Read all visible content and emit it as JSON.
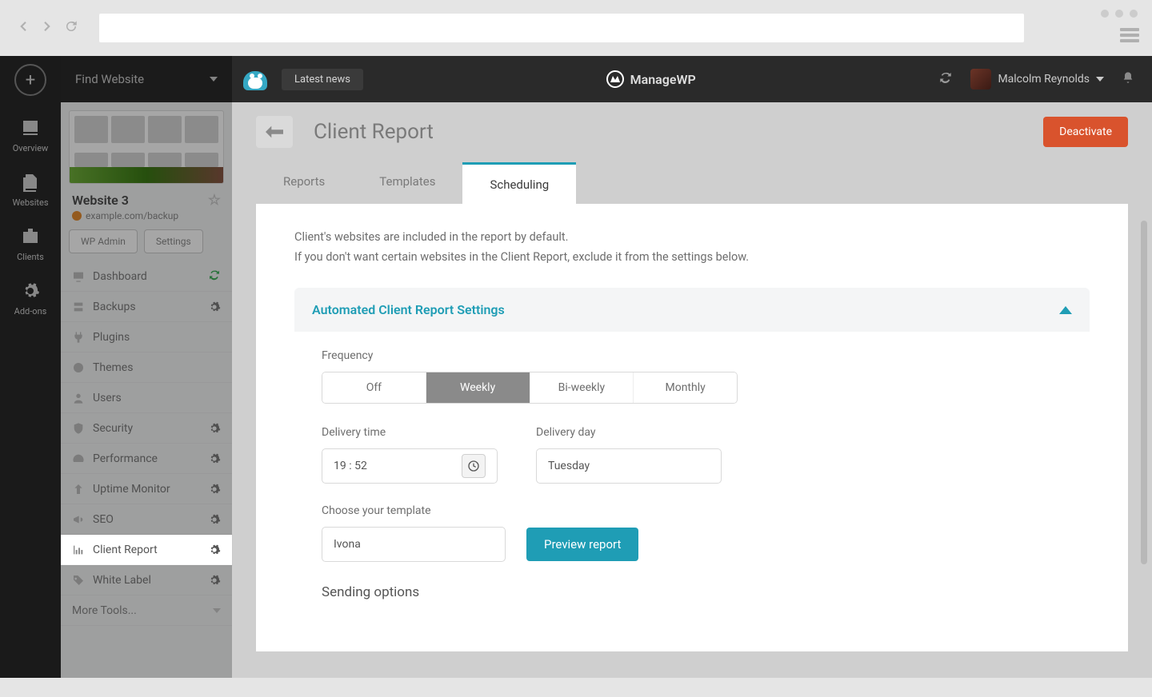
{
  "browser": {},
  "topbar": {
    "latest_news": "Latest news",
    "brand": "ManageWP",
    "user_name": "Malcolm Reynolds"
  },
  "rail": {
    "overview": "Overview",
    "websites": "Websites",
    "clients": "Clients",
    "addons": "Add-ons"
  },
  "site_col": {
    "find": "Find Website",
    "site_title": "Website 3",
    "site_url": "example.com/backup",
    "wp_admin": "WP Admin",
    "settings": "Settings",
    "menu": {
      "dashboard": "Dashboard",
      "backups": "Backups",
      "plugins": "Plugins",
      "themes": "Themes",
      "users": "Users",
      "security": "Security",
      "performance": "Performance",
      "uptime": "Uptime Monitor",
      "seo": "SEO",
      "client_report": "Client Report",
      "white_label": "White Label",
      "more": "More Tools..."
    }
  },
  "page": {
    "title": "Client Report",
    "deactivate": "Deactivate",
    "tabs": {
      "reports": "Reports",
      "templates": "Templates",
      "scheduling": "Scheduling"
    },
    "intro_line1": "Client's websites are included in the report by default.",
    "intro_line2": "If you don't want certain websites in the Client Report, exclude it from the settings below.",
    "panel_title": "Automated Client Report Settings",
    "frequency_label": "Frequency",
    "frequency": {
      "off": "Off",
      "weekly": "Weekly",
      "biweekly": "Bi-weekly",
      "monthly": "Monthly"
    },
    "delivery_time_label": "Delivery time",
    "delivery_time": "19 : 52",
    "delivery_day_label": "Delivery day",
    "delivery_day": "Tuesday",
    "template_label": "Choose your template",
    "template_value": "Ivona",
    "preview": "Preview report",
    "sending_options": "Sending options"
  }
}
